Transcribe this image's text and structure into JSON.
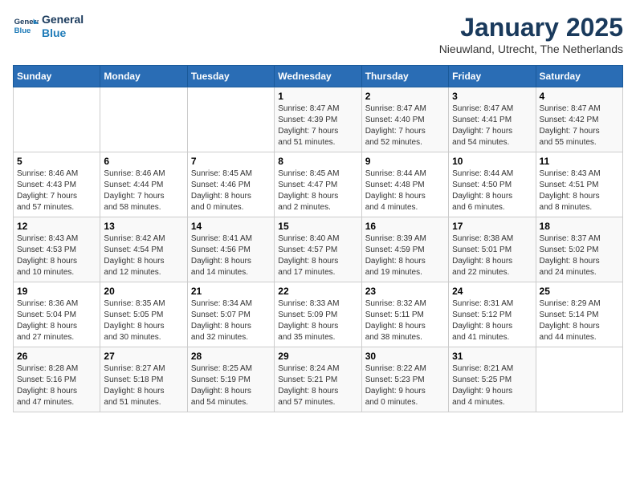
{
  "logo": {
    "line1": "General",
    "line2": "Blue"
  },
  "header": {
    "title": "January 2025",
    "location": "Nieuwland, Utrecht, The Netherlands"
  },
  "weekdays": [
    "Sunday",
    "Monday",
    "Tuesday",
    "Wednesday",
    "Thursday",
    "Friday",
    "Saturday"
  ],
  "weeks": [
    [
      {
        "day": "",
        "info": ""
      },
      {
        "day": "",
        "info": ""
      },
      {
        "day": "",
        "info": ""
      },
      {
        "day": "1",
        "info": "Sunrise: 8:47 AM\nSunset: 4:39 PM\nDaylight: 7 hours\nand 51 minutes."
      },
      {
        "day": "2",
        "info": "Sunrise: 8:47 AM\nSunset: 4:40 PM\nDaylight: 7 hours\nand 52 minutes."
      },
      {
        "day": "3",
        "info": "Sunrise: 8:47 AM\nSunset: 4:41 PM\nDaylight: 7 hours\nand 54 minutes."
      },
      {
        "day": "4",
        "info": "Sunrise: 8:47 AM\nSunset: 4:42 PM\nDaylight: 7 hours\nand 55 minutes."
      }
    ],
    [
      {
        "day": "5",
        "info": "Sunrise: 8:46 AM\nSunset: 4:43 PM\nDaylight: 7 hours\nand 57 minutes."
      },
      {
        "day": "6",
        "info": "Sunrise: 8:46 AM\nSunset: 4:44 PM\nDaylight: 7 hours\nand 58 minutes."
      },
      {
        "day": "7",
        "info": "Sunrise: 8:45 AM\nSunset: 4:46 PM\nDaylight: 8 hours\nand 0 minutes."
      },
      {
        "day": "8",
        "info": "Sunrise: 8:45 AM\nSunset: 4:47 PM\nDaylight: 8 hours\nand 2 minutes."
      },
      {
        "day": "9",
        "info": "Sunrise: 8:44 AM\nSunset: 4:48 PM\nDaylight: 8 hours\nand 4 minutes."
      },
      {
        "day": "10",
        "info": "Sunrise: 8:44 AM\nSunset: 4:50 PM\nDaylight: 8 hours\nand 6 minutes."
      },
      {
        "day": "11",
        "info": "Sunrise: 8:43 AM\nSunset: 4:51 PM\nDaylight: 8 hours\nand 8 minutes."
      }
    ],
    [
      {
        "day": "12",
        "info": "Sunrise: 8:43 AM\nSunset: 4:53 PM\nDaylight: 8 hours\nand 10 minutes."
      },
      {
        "day": "13",
        "info": "Sunrise: 8:42 AM\nSunset: 4:54 PM\nDaylight: 8 hours\nand 12 minutes."
      },
      {
        "day": "14",
        "info": "Sunrise: 8:41 AM\nSunset: 4:56 PM\nDaylight: 8 hours\nand 14 minutes."
      },
      {
        "day": "15",
        "info": "Sunrise: 8:40 AM\nSunset: 4:57 PM\nDaylight: 8 hours\nand 17 minutes."
      },
      {
        "day": "16",
        "info": "Sunrise: 8:39 AM\nSunset: 4:59 PM\nDaylight: 8 hours\nand 19 minutes."
      },
      {
        "day": "17",
        "info": "Sunrise: 8:38 AM\nSunset: 5:01 PM\nDaylight: 8 hours\nand 22 minutes."
      },
      {
        "day": "18",
        "info": "Sunrise: 8:37 AM\nSunset: 5:02 PM\nDaylight: 8 hours\nand 24 minutes."
      }
    ],
    [
      {
        "day": "19",
        "info": "Sunrise: 8:36 AM\nSunset: 5:04 PM\nDaylight: 8 hours\nand 27 minutes."
      },
      {
        "day": "20",
        "info": "Sunrise: 8:35 AM\nSunset: 5:05 PM\nDaylight: 8 hours\nand 30 minutes."
      },
      {
        "day": "21",
        "info": "Sunrise: 8:34 AM\nSunset: 5:07 PM\nDaylight: 8 hours\nand 32 minutes."
      },
      {
        "day": "22",
        "info": "Sunrise: 8:33 AM\nSunset: 5:09 PM\nDaylight: 8 hours\nand 35 minutes."
      },
      {
        "day": "23",
        "info": "Sunrise: 8:32 AM\nSunset: 5:11 PM\nDaylight: 8 hours\nand 38 minutes."
      },
      {
        "day": "24",
        "info": "Sunrise: 8:31 AM\nSunset: 5:12 PM\nDaylight: 8 hours\nand 41 minutes."
      },
      {
        "day": "25",
        "info": "Sunrise: 8:29 AM\nSunset: 5:14 PM\nDaylight: 8 hours\nand 44 minutes."
      }
    ],
    [
      {
        "day": "26",
        "info": "Sunrise: 8:28 AM\nSunset: 5:16 PM\nDaylight: 8 hours\nand 47 minutes."
      },
      {
        "day": "27",
        "info": "Sunrise: 8:27 AM\nSunset: 5:18 PM\nDaylight: 8 hours\nand 51 minutes."
      },
      {
        "day": "28",
        "info": "Sunrise: 8:25 AM\nSunset: 5:19 PM\nDaylight: 8 hours\nand 54 minutes."
      },
      {
        "day": "29",
        "info": "Sunrise: 8:24 AM\nSunset: 5:21 PM\nDaylight: 8 hours\nand 57 minutes."
      },
      {
        "day": "30",
        "info": "Sunrise: 8:22 AM\nSunset: 5:23 PM\nDaylight: 9 hours\nand 0 minutes."
      },
      {
        "day": "31",
        "info": "Sunrise: 8:21 AM\nSunset: 5:25 PM\nDaylight: 9 hours\nand 4 minutes."
      },
      {
        "day": "",
        "info": ""
      }
    ]
  ]
}
